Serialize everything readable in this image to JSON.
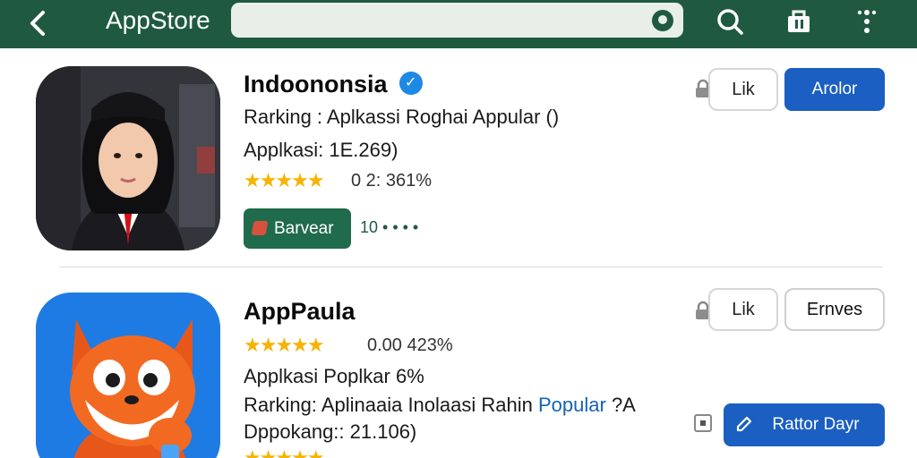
{
  "topbar": {
    "title": "AppStore",
    "icons": [
      "back-arrow-icon",
      "mic-icon",
      "search-icon",
      "bag-icon",
      "more-icon"
    ],
    "color": "#1f5a40"
  },
  "apps": [
    {
      "title": "Indoononsia",
      "ranking": "Rarking : Aplkassi Roghai Appular ()",
      "applkasi": "Applkasi: 1E.269)",
      "stars_text": "0 2: 361%",
      "tag_label": "Barvear",
      "dots": "10 • • • •",
      "like_label": "Lik",
      "action_label": "Arolor"
    },
    {
      "title": "AppPaula",
      "stars_text": "0.00 423%",
      "applkasi": "Applkasi Poplkar 6%",
      "ranking_prefix": "Rarking: Aplinaaia Inolaasi Rahin ",
      "ranking_highlight": "Popular",
      "ranking_suffix": " ?A",
      "downloads": "Dppokang:: 21.106)",
      "like_label": "Lik",
      "action_label": "Ernves",
      "primary_label": "Rattor Dayr"
    }
  ],
  "colors": {
    "accent_blue": "#1a5fc1",
    "star": "#f5b400",
    "green_button": "#1f6b4c"
  }
}
